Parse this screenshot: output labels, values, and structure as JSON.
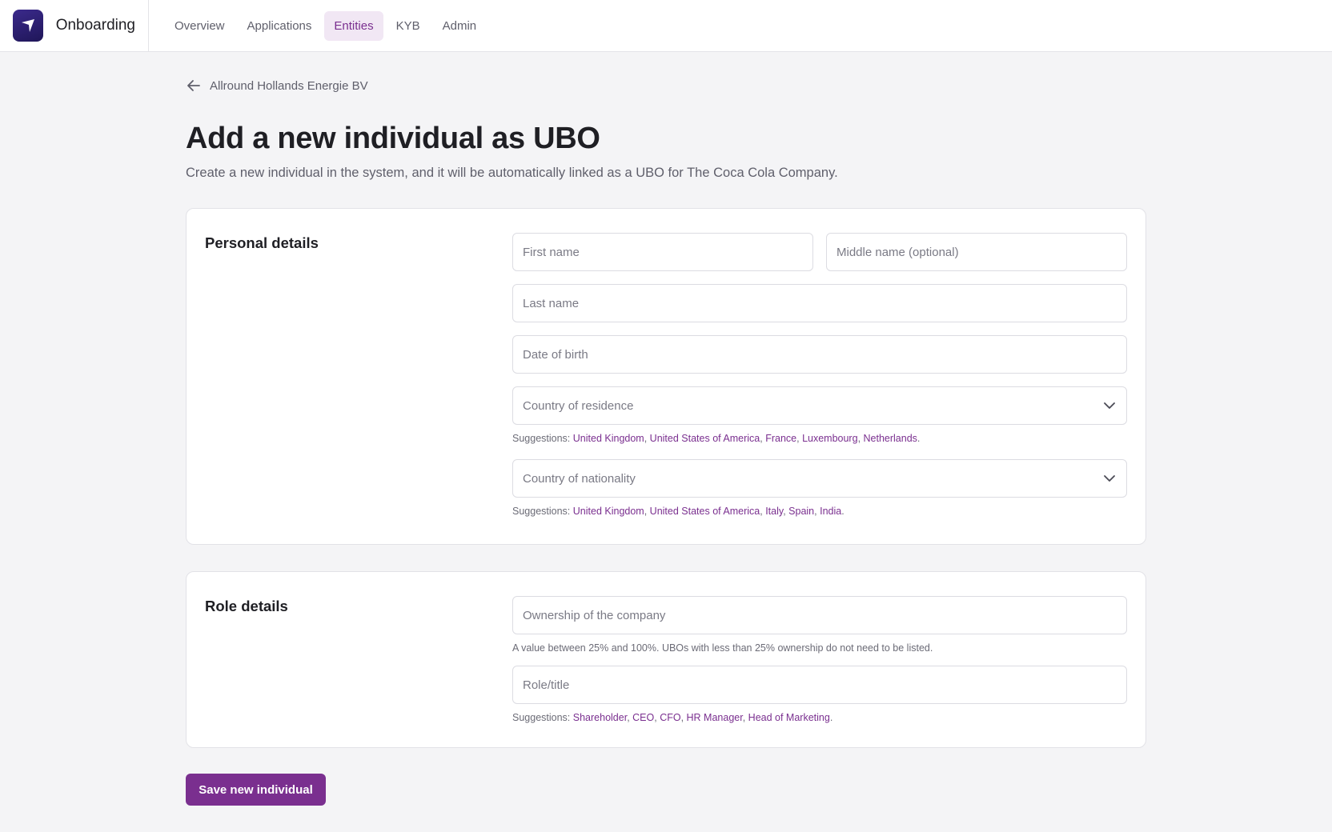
{
  "header": {
    "brand": "Onboarding",
    "nav": [
      {
        "label": "Overview",
        "active": false
      },
      {
        "label": "Applications",
        "active": false
      },
      {
        "label": "Entities",
        "active": true
      },
      {
        "label": "KYB",
        "active": false
      },
      {
        "label": "Admin",
        "active": false
      }
    ]
  },
  "breadcrumb": {
    "back_label": "Allround Hollands Energie BV"
  },
  "page": {
    "title": "Add a new individual as UBO",
    "subtitle": "Create a new individual in the system, and it will be automatically linked as a UBO for The Coca Cola Company."
  },
  "personal": {
    "title": "Personal details",
    "first_name_placeholder": "First name",
    "middle_name_placeholder": "Middle name (optional)",
    "last_name_placeholder": "Last name",
    "dob_placeholder": "Date of birth",
    "residence_label": "Country of residence",
    "residence_suggestions_prefix": "Suggestions:",
    "residence_suggestions": [
      "United Kingdom",
      "United States of America",
      "France",
      "Luxembourg",
      "Netherlands"
    ],
    "nationality_label": "Country of nationality",
    "nationality_suggestions_prefix": "Suggestions:",
    "nationality_suggestions": [
      "United Kingdom",
      "United States of America",
      "Italy",
      "Spain",
      "India"
    ]
  },
  "role": {
    "title": "Role details",
    "ownership_placeholder": "Ownership of the company",
    "ownership_hint": "A value between 25% and 100%. UBOs with less than 25% ownership do not need to be listed.",
    "role_placeholder": "Role/title",
    "role_suggestions_prefix": "Suggestions:",
    "role_suggestions": [
      "Shareholder",
      "CEO",
      "CFO",
      "HR Manager",
      "Head of Marketing"
    ]
  },
  "actions": {
    "save_label": "Save new individual"
  },
  "colors": {
    "accent": "#7a2f8f",
    "logo": "#2a1f70",
    "nav_active_bg": "#f1e7f4"
  }
}
